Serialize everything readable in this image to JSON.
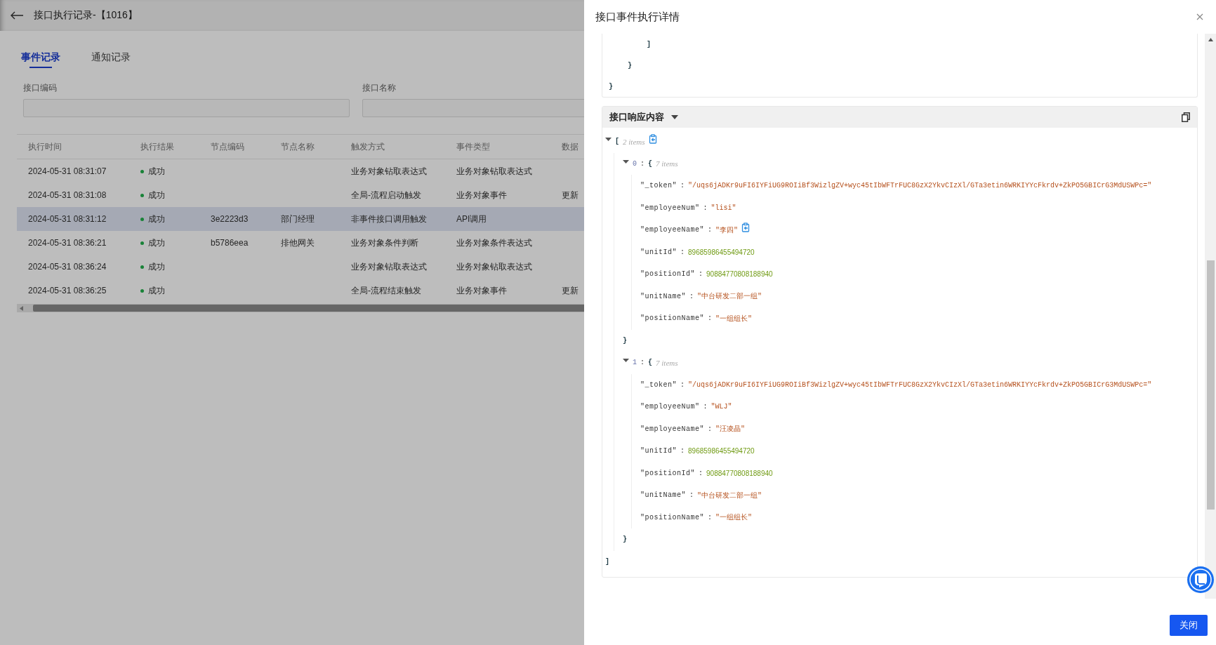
{
  "page": {
    "title": "接口执行记录-【1016】",
    "tabs": [
      {
        "label": "事件记录",
        "selected": true
      },
      {
        "label": "通知记录",
        "selected": false
      }
    ],
    "filters": [
      {
        "label": "接口编码"
      },
      {
        "label": "接口名称"
      }
    ],
    "table": {
      "columns": [
        "执行时间",
        "执行结果",
        "节点编码",
        "节点名称",
        "触发方式",
        "事件类型",
        "数据"
      ],
      "rows": [
        {
          "selected": false,
          "cells": [
            "2024-05-31 08:31:07",
            "成功",
            "",
            "",
            "业务对象钻取表达式",
            "业务对象钻取表达式",
            ""
          ],
          "success": true
        },
        {
          "selected": false,
          "cells": [
            "2024-05-31 08:31:08",
            "成功",
            "",
            "",
            "全局-流程启动触发",
            "业务对象事件",
            "更新"
          ],
          "success": true
        },
        {
          "selected": true,
          "cells": [
            "2024-05-31 08:31:12",
            "成功",
            "3e2223d3",
            "部门经理",
            "非事件接口调用触发",
            "API调用",
            ""
          ],
          "success": true
        },
        {
          "selected": false,
          "cells": [
            "2024-05-31 08:36:21",
            "成功",
            "b5786eea",
            "排他网关",
            "业务对象条件判断",
            "业务对象条件表达式",
            ""
          ],
          "success": true
        },
        {
          "selected": false,
          "cells": [
            "2024-05-31 08:36:24",
            "成功",
            "",
            "",
            "业务对象钻取表达式",
            "业务对象钻取表达式",
            ""
          ],
          "success": true
        },
        {
          "selected": false,
          "cells": [
            "2024-05-31 08:36:25",
            "成功",
            "",
            "",
            "全局-流程结束触发",
            "业务对象事件",
            "更新"
          ],
          "success": true
        }
      ]
    }
  },
  "drawer": {
    "title": "接口事件执行详情",
    "request_tail": {
      "text": "}",
      "children": [
        {
          "text": "}",
          "children": [
            {
              "text": "]"
            }
          ]
        }
      ]
    },
    "response": {
      "title": "接口响应内容",
      "separator": ":",
      "root": {
        "open": "[",
        "close": "]",
        "count": "2 items",
        "expanded": true,
        "copy_shown": true,
        "items": [
          {
            "index": "0",
            "open": "{",
            "close": "}",
            "count": "7 items",
            "expanded": true,
            "fields": [
              {
                "key": "\"_token\"",
                "value": "\"/uqs6jADKr9uFI6IYFiUG9ROIiBf3WizlgZV+wyc45tIbWFTrFUC8GzX2YkvCIzXl/GTa3etin6WRKIYYcFkrdv+ZkPO5GBICrG3MdUSWPc=\"",
                "kind": "string",
                "copy_shown": false
              },
              {
                "key": "\"employeeNum\"",
                "value": "\"lisi\"",
                "kind": "string",
                "copy_shown": false
              },
              {
                "key": "\"employeeName\"",
                "value": "\"李四\"",
                "kind": "string",
                "copy_shown": true
              },
              {
                "key": "\"unitId\"",
                "value": "89685986455494720",
                "kind": "number",
                "copy_shown": false
              },
              {
                "key": "\"positionId\"",
                "value": "90884770808188940",
                "kind": "number",
                "copy_shown": false
              },
              {
                "key": "\"unitName\"",
                "value": "\"中台研发二部一组\"",
                "kind": "string",
                "copy_shown": false
              },
              {
                "key": "\"positionName\"",
                "value": "\"一组组长\"",
                "kind": "string",
                "copy_shown": false
              }
            ]
          },
          {
            "index": "1",
            "open": "{",
            "close": "}",
            "count": "7 items",
            "expanded": true,
            "fields": [
              {
                "key": "\"_token\"",
                "value": "\"/uqs6jADKr9uFI6IYFiUG9ROIiBf3WizlgZV+wyc45tIbWFTrFUC8GzX2YkvCIzXl/GTa3etin6WRKIYYcFkrdv+ZkPO5GBICrG3MdUSWPc=\"",
                "kind": "string",
                "copy_shown": false
              },
              {
                "key": "\"employeeNum\"",
                "value": "\"WLJ\"",
                "kind": "string",
                "copy_shown": false
              },
              {
                "key": "\"employeeName\"",
                "value": "\"汪凌晶\"",
                "kind": "string",
                "copy_shown": false
              },
              {
                "key": "\"unitId\"",
                "value": "89685986455494720",
                "kind": "number",
                "copy_shown": false
              },
              {
                "key": "\"positionId\"",
                "value": "90884770808188940",
                "kind": "number",
                "copy_shown": false
              },
              {
                "key": "\"unitName\"",
                "value": "\"中台研发二部一组\"",
                "kind": "string",
                "copy_shown": false
              },
              {
                "key": "\"positionName\"",
                "value": "\"一组组长\"",
                "kind": "string",
                "copy_shown": false
              }
            ]
          }
        ]
      }
    },
    "close_button": "关闭"
  }
}
